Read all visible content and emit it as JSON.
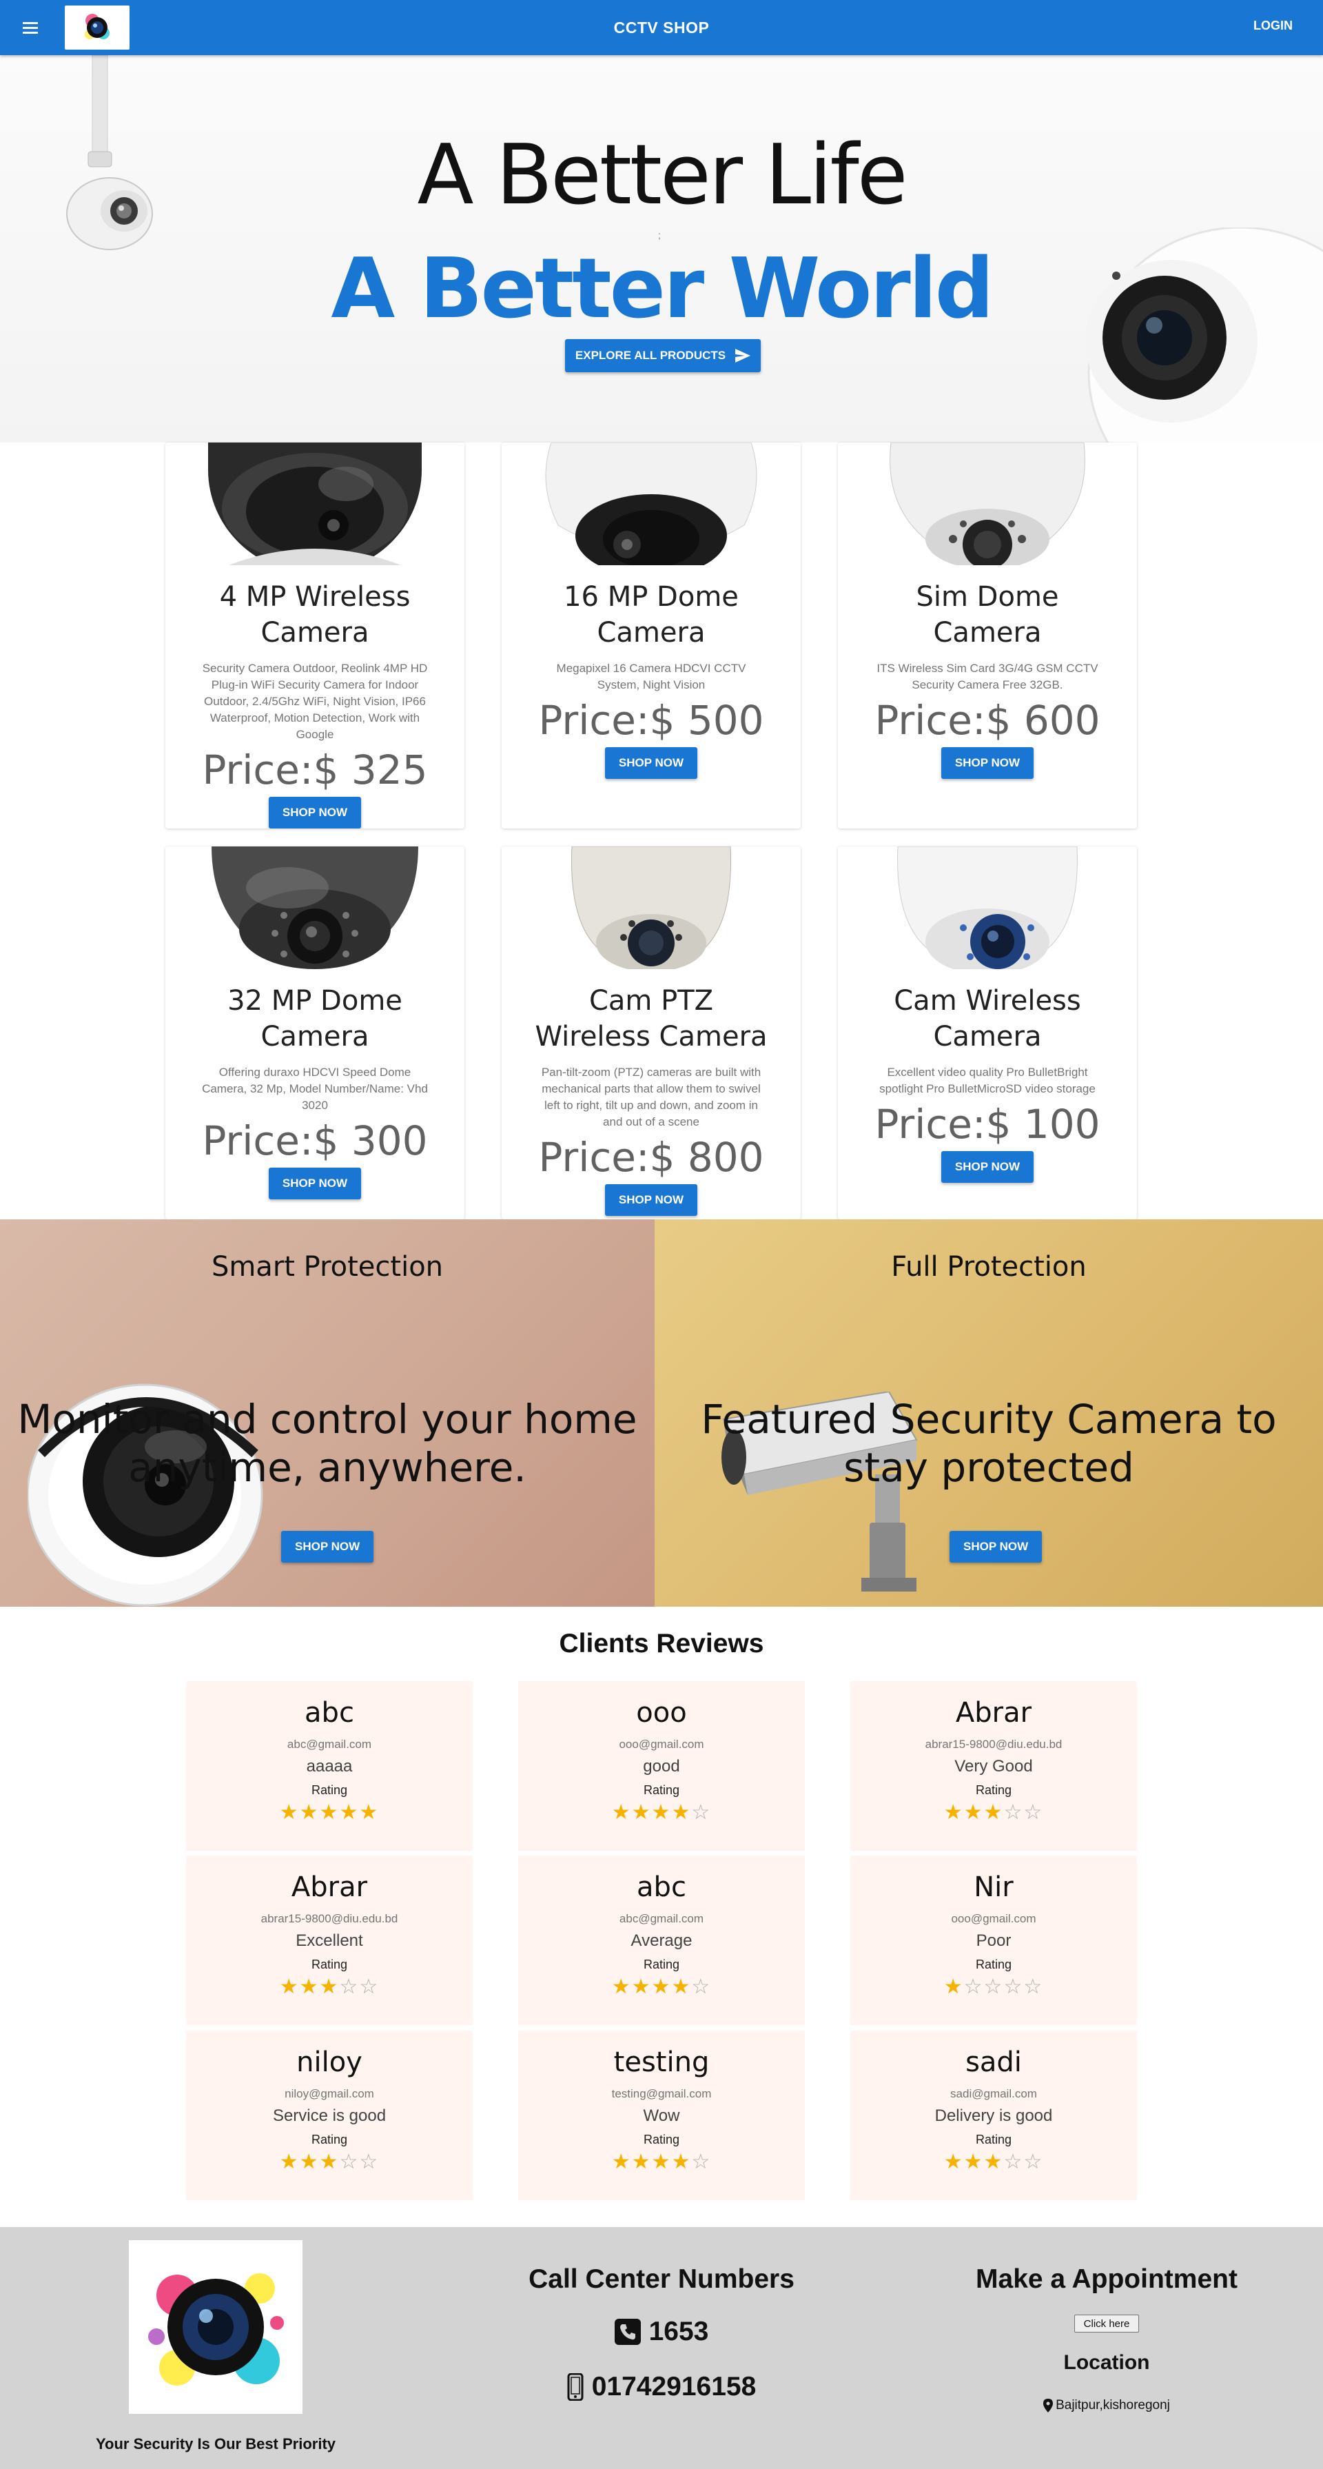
{
  "header": {
    "title": "CCTV SHOP",
    "login_label": "LOGIN",
    "menu_icon": "menu-icon",
    "logo_icon": "camera-logo"
  },
  "hero": {
    "title_line1": "A Better Life",
    "separator": ";",
    "title_line2": "A Better World",
    "explore_label": "EXPLORE ALL PRODUCTS",
    "explore_icon": "send-icon"
  },
  "products": [
    {
      "title": "4 MP Wireless Camera",
      "description": "Security Camera Outdoor, Reolink 4MP HD Plug-in WiFi Security Camera for Indoor Outdoor, 2.4/5Ghz WiFi, Night Vision, IP66 Waterproof, Motion Detection, Work with Google",
      "price": "Price:$ 325",
      "button": "SHOP NOW"
    },
    {
      "title": "16 MP Dome Camera",
      "description": "Megapixel 16 Camera HDCVI CCTV System, Night Vision",
      "price": "Price:$ 500",
      "button": "SHOP NOW"
    },
    {
      "title": "Sim Dome Camera",
      "description": "ITS Wireless Sim Card 3G/4G GSM CCTV Security Camera Free 32GB.",
      "price": "Price:$ 600",
      "button": "SHOP NOW"
    },
    {
      "title": "32 MP Dome Camera",
      "description": "Offering duraxo HDCVI Speed Dome Camera, 32 Mp, Model Number/Name: Vhd 3020",
      "price": "Price:$ 300",
      "button": "SHOP NOW"
    },
    {
      "title": "Cam PTZ Wireless Camera",
      "description": "Pan-tilt-zoom (PTZ) cameras are built with mechanical parts that allow them to swivel left to right, tilt up and down, and zoom in and out of a scene",
      "price": "Price:$ 800",
      "button": "SHOP NOW"
    },
    {
      "title": "Cam Wireless Camera",
      "description": "Excellent video quality Pro BulletBright spotlight Pro BulletMicroSD video storage",
      "price": "Price:$ 100",
      "button": "SHOP NOW"
    }
  ],
  "promos": [
    {
      "heading": "Smart Protection",
      "text": "Monitor and control your home anytime, anywhere.",
      "button": "SHOP NOW"
    },
    {
      "heading": "Full Protection",
      "text": "Featured Security Camera to stay protected",
      "button": "SHOP NOW"
    }
  ],
  "reviews": {
    "title": "Clients Reviews",
    "rating_label": "Rating",
    "items": [
      {
        "name": "abc",
        "email": "abc@gmail.com",
        "comment": "aaaaa",
        "rating": 5
      },
      {
        "name": "ooo",
        "email": "ooo@gmail.com",
        "comment": "good",
        "rating": 4
      },
      {
        "name": "Abrar",
        "email": "abrar15-9800@diu.edu.bd",
        "comment": "Very Good",
        "rating": 3
      },
      {
        "name": "Abrar",
        "email": "abrar15-9800@diu.edu.bd",
        "comment": "Excellent",
        "rating": 3
      },
      {
        "name": "abc",
        "email": "abc@gmail.com",
        "comment": "Average",
        "rating": 4
      },
      {
        "name": "Nir",
        "email": "ooo@gmail.com",
        "comment": "Poor",
        "rating": 1
      },
      {
        "name": "niloy",
        "email": "niloy@gmail.com",
        "comment": "Service is good",
        "rating": 3
      },
      {
        "name": "testing",
        "email": "testing@gmail.com",
        "comment": "Wow",
        "rating": 4
      },
      {
        "name": "sadi",
        "email": "sadi@gmail.com",
        "comment": "Delivery is good",
        "rating": 3
      }
    ]
  },
  "footer": {
    "tagline": "Your Security Is Our Best Priority",
    "call_center_title": "Call Center Numbers",
    "phone1": "1653",
    "phone1_icon": "phone-square-icon",
    "phone2": "01742916158",
    "phone2_icon": "mobile-phone-icon",
    "appointment_title": "Make a Appointment",
    "appointment_button": "Click here",
    "location_title": "Location",
    "location": "Bajitpur,kishoregonj",
    "location_icon": "map-pin-icon"
  },
  "colors": {
    "primary": "#1976d2",
    "star": "#f5b300",
    "review_bg": "#fff4ef",
    "footer_bg": "#d3d3d3"
  }
}
